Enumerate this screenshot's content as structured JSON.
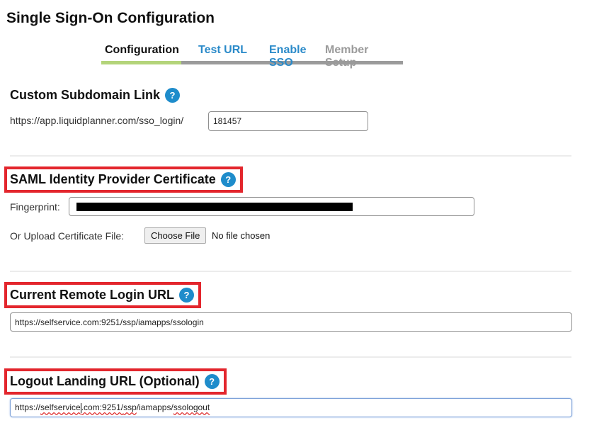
{
  "page": {
    "title": "Single Sign-On Configuration"
  },
  "tabs": [
    {
      "label": "Configuration",
      "state": "active"
    },
    {
      "label": "Test URL",
      "state": "link"
    },
    {
      "label": "Enable SSO",
      "state": "link"
    },
    {
      "label": "Member Setup",
      "state": "disabled"
    }
  ],
  "colors": {
    "accent": "#2a8ac9",
    "active_tab_underline": "#b4d47a",
    "tab_underline": "#9b9b9b",
    "highlight_box": "#e3262d",
    "help_icon": "#1e8ccb"
  },
  "subdomain": {
    "heading": "Custom Subdomain Link",
    "help_icon": "?",
    "prefix": "https://app.liquidplanner.com/sso_login/",
    "value": "181457"
  },
  "certificate": {
    "heading": "SAML Identity Provider Certificate",
    "help_icon": "?",
    "fingerprint_label": "Fingerprint:",
    "fingerprint_value": "[redacted]",
    "upload_label": "Or Upload Certificate File:",
    "choose_file_label": "Choose File",
    "no_file_text": "No file chosen"
  },
  "remote_login": {
    "heading": "Current Remote Login URL",
    "help_icon": "?",
    "value": "https://selfservice.com:9251/ssp/iamapps/ssologin"
  },
  "logout": {
    "heading": "Logout Landing URL (Optional)",
    "help_icon": "?",
    "value_parts": [
      "https://",
      "selfservice",
      ".com:9251/",
      "ssp",
      "/iamapps/",
      "ssologout"
    ]
  }
}
